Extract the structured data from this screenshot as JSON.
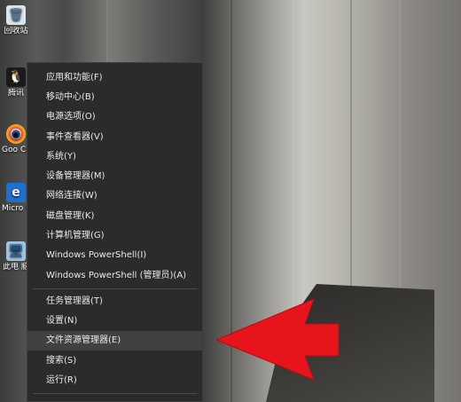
{
  "desktop": {
    "icons": [
      {
        "label": "回收站",
        "icon": "recycle-bin-icon",
        "glyph": "🗑"
      },
      {
        "label": "腾讯",
        "icon": "qq-icon",
        "glyph": "🐧"
      },
      {
        "label": "Goo Chro",
        "icon": "chrome-icon",
        "glyph": "◉"
      },
      {
        "label": "Micro Ed",
        "icon": "edge-icon",
        "glyph": "e"
      },
      {
        "label": "此电 脑",
        "icon": "this-pc-icon",
        "glyph": "🖥"
      }
    ]
  },
  "context_menu": {
    "items": [
      {
        "label": "应用和功能(F)"
      },
      {
        "label": "移动中心(B)"
      },
      {
        "label": "电源选项(O)"
      },
      {
        "label": "事件查看器(V)"
      },
      {
        "label": "系统(Y)"
      },
      {
        "label": "设备管理器(M)"
      },
      {
        "label": "网络连接(W)"
      },
      {
        "label": "磁盘管理(K)"
      },
      {
        "label": "计算机管理(G)"
      },
      {
        "label": "Windows PowerShell(I)"
      },
      {
        "label": "Windows PowerShell (管理员)(A)"
      },
      {
        "label": "任务管理器(T)"
      },
      {
        "label": "设置(N)"
      },
      {
        "label": "文件资源管理器(E)",
        "highlighted": true
      },
      {
        "label": "搜索(S)"
      },
      {
        "label": "运行(R)"
      }
    ]
  },
  "annotation": {
    "arrow_color": "#e8141c"
  },
  "colors": {
    "menu_bg": "#2b2b2b",
    "menu_text": "#e9e9e9",
    "highlight": "#414141"
  }
}
